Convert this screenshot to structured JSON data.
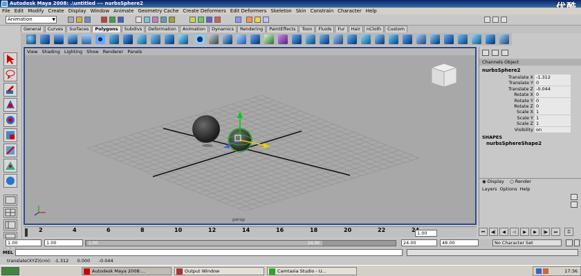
{
  "window": {
    "title": "Autodesk Maya 2008: .\\untitled   ---   nurbsSphere2"
  },
  "watermark": "优酷",
  "menubar": [
    "File",
    "Edit",
    "Modify",
    "Create",
    "Display",
    "Window",
    "Animate",
    "Geometry Cache",
    "Create Deformers",
    "Edit Deformers",
    "Skeleton",
    "Skin",
    "Constrain",
    "Character",
    "Help"
  ],
  "statusline": {
    "mode": "Animation"
  },
  "shelf_tabs": [
    "General",
    "Curves",
    "Surfaces",
    "Polygons",
    "Subdivs",
    "Deformation",
    "Animation",
    "Dynamics",
    "Rendering",
    "PaintEffects",
    "Toon",
    "Fluids",
    "Fur",
    "Hair",
    "nCloth",
    "Custom"
  ],
  "shelf_active_tab": "Polygons",
  "panel_menu": [
    "View",
    "Shading",
    "Lighting",
    "Show",
    "Renderer",
    "Panels"
  ],
  "viewport": {
    "camera_label": "persp"
  },
  "channel_box": {
    "header": [
      "Channels",
      "Object"
    ],
    "node": "nurbsSphere2",
    "channels": [
      {
        "label": "Translate X",
        "value": "-1.312"
      },
      {
        "label": "Translate Y",
        "value": "0"
      },
      {
        "label": "Translate Z",
        "value": "-0.044"
      },
      {
        "label": "Rotate X",
        "value": "0"
      },
      {
        "label": "Rotate Y",
        "value": "0"
      },
      {
        "label": "Rotate Z",
        "value": "0"
      },
      {
        "label": "Scale X",
        "value": "1"
      },
      {
        "label": "Scale Y",
        "value": "1"
      },
      {
        "label": "Scale Z",
        "value": "1"
      },
      {
        "label": "Visibility",
        "value": "on"
      }
    ],
    "shapes_label": "SHAPES",
    "shape_name": "nurbsSphereShape2"
  },
  "layer_editor": {
    "display_label": "Display",
    "render_label": "Render",
    "menu": [
      "Layers",
      "Options",
      "Help"
    ]
  },
  "timeslider": {
    "ticks": [
      "2",
      "4",
      "6",
      "8",
      "10",
      "12",
      "14",
      "16",
      "18",
      "20",
      "22",
      "24"
    ],
    "current_frame": "1.00"
  },
  "range": {
    "start": "1.00",
    "start_inner": "1.00",
    "slider_left": "1.00",
    "slider_right": "24.00",
    "end_inner": "24.00",
    "end": "48.00",
    "character_set": "No Character Set"
  },
  "cmdline": {
    "label": "MEL"
  },
  "helpline": "translate(XYZ)(cm):  -1.312      0.000      -0.044",
  "taskbar": {
    "items": [
      "Autodesk Maya 2008:...",
      "Output Window",
      "Camtasia Studio - U..."
    ],
    "clock": "17:36"
  }
}
